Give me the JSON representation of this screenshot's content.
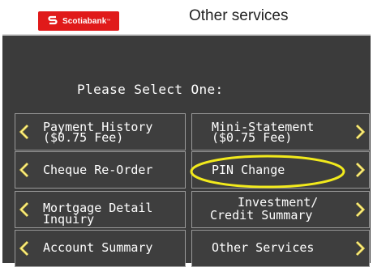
{
  "header": {
    "brand": "Scotiabank",
    "title": "Other services"
  },
  "prompt": "Please Select One:",
  "options": {
    "payment_history": {
      "line1": "Payment History",
      "line2": "($0.75 Fee)"
    },
    "mini_statement": {
      "line1": "Mini-Statement",
      "line2": "($0.75 Fee)"
    },
    "cheque_reorder": {
      "line1": "Cheque Re-Order"
    },
    "pin_change": {
      "line1": "PIN Change"
    },
    "mortgage_detail": {
      "line1": "Mortgage Detail",
      "line2": "Inquiry"
    },
    "investment_summary": {
      "line1": "Investment/",
      "line2": "Credit Summary"
    },
    "account_summary": {
      "line1": "Account Summary"
    },
    "other_services": {
      "line1": "Other Services"
    }
  },
  "colors": {
    "brand_red": "#e01a1a",
    "screen_bg": "#3b3b3b",
    "arrow_yellow": "#e8d44a",
    "highlight_yellow": "#f2ea1c"
  },
  "icons": {
    "left_arrow": "chevron-left-icon",
    "right_arrow": "chevron-right-icon",
    "logo": "scotiabank-logo"
  }
}
